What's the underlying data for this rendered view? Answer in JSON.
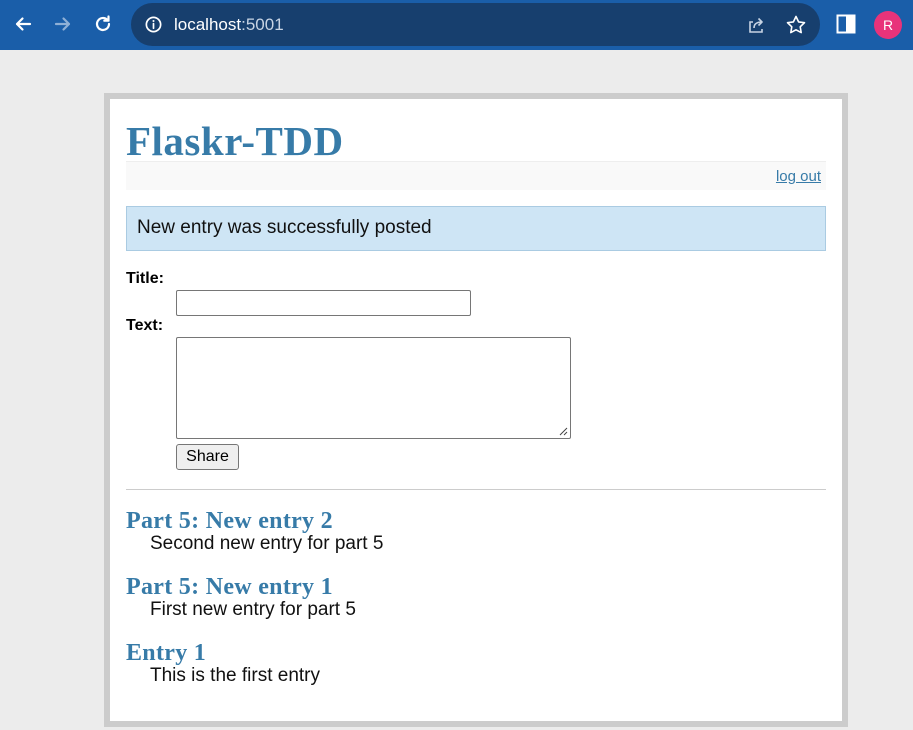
{
  "browser": {
    "url_host": "localhost",
    "url_port": ":5001",
    "avatar_initial": "R",
    "icons": [
      "back-icon",
      "forward-icon",
      "reload-icon",
      "info-icon",
      "share-icon",
      "bookmark-star-icon",
      "side-panel-icon"
    ]
  },
  "page": {
    "title": "Flaskr-TDD",
    "logout_label": "log out",
    "flash_message": "New entry was successfully posted",
    "form": {
      "title_label": "Title:",
      "title_value": "",
      "text_label": "Text:",
      "text_value": "",
      "submit_label": "Share"
    },
    "entries": [
      {
        "title": "Part 5: New entry 2",
        "text": "Second new entry for part 5"
      },
      {
        "title": "Part 5: New entry 1",
        "text": "First new entry for part 5"
      },
      {
        "title": "Entry 1",
        "text": "This is the first entry"
      }
    ]
  },
  "colors": {
    "chrome": "#1a5ea9",
    "omnibox": "#173f6e",
    "link": "#377ba8",
    "flash_bg": "#cee5f5",
    "avatar": "#e8337a"
  }
}
